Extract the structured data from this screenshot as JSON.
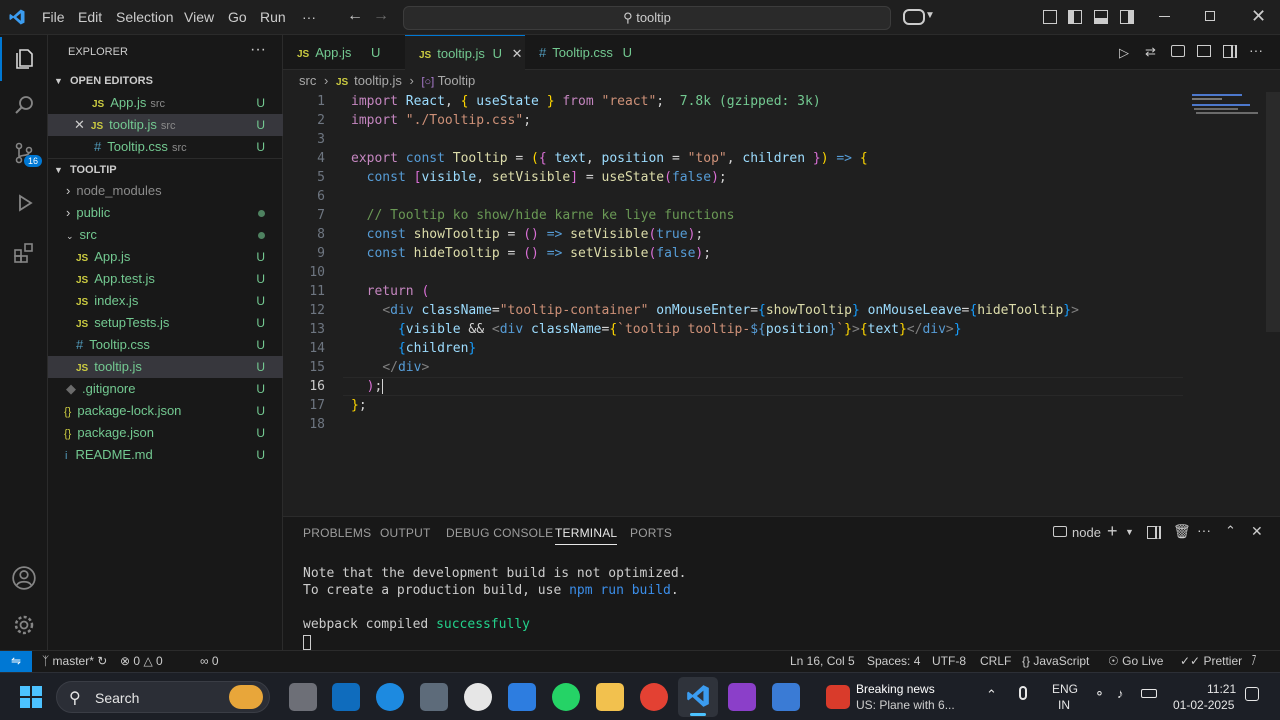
{
  "menu": [
    "File",
    "Edit",
    "Selection",
    "View",
    "Go",
    "Run",
    "···"
  ],
  "command_center": "tooltip",
  "explorer": {
    "title": "EXPLORER",
    "open_editors_label": "OPEN EDITORS",
    "open_editors": [
      {
        "icon": "JS",
        "name": "App.js",
        "dir": "src",
        "status": "U"
      },
      {
        "icon": "JS",
        "name": "tooltip.js",
        "dir": "src",
        "status": "U"
      },
      {
        "icon": "#",
        "name": "Tooltip.css",
        "dir": "src",
        "status": "U"
      }
    ],
    "project_label": "TOOLTIP",
    "tree": [
      {
        "name": "node_modules",
        "status": ""
      },
      {
        "name": "public",
        "status": "dot"
      },
      {
        "name": "src",
        "status": "dot"
      },
      {
        "name": "App.js",
        "icon": "JS",
        "status": "U"
      },
      {
        "name": "App.test.js",
        "icon": "JS",
        "status": "U"
      },
      {
        "name": "index.js",
        "icon": "JS",
        "status": "U"
      },
      {
        "name": "setupTests.js",
        "icon": "JS",
        "status": "U"
      },
      {
        "name": "Tooltip.css",
        "icon": "#",
        "status": "U"
      },
      {
        "name": "tooltip.js",
        "icon": "JS",
        "status": "U"
      },
      {
        "name": ".gitignore",
        "status": "U"
      },
      {
        "name": "package-lock.json",
        "icon": "{}",
        "status": "U"
      },
      {
        "name": "package.json",
        "icon": "{}",
        "status": "U"
      },
      {
        "name": "README.md",
        "icon": "i",
        "status": "U"
      }
    ],
    "source_control_badge": "16"
  },
  "tabs": [
    {
      "icon": "JS",
      "label": "App.js",
      "status": "U"
    },
    {
      "icon": "JS",
      "label": "tooltip.js",
      "status": "U"
    },
    {
      "icon": "#",
      "label": "Tooltip.css",
      "status": "U"
    }
  ],
  "breadcrumb": {
    "a": "src",
    "b": "tooltip.js",
    "c": "Tooltip"
  },
  "line_numbers": [
    "1",
    "2",
    "3",
    "4",
    "5",
    "6",
    "7",
    "8",
    "9",
    "10",
    "11",
    "12",
    "13",
    "14",
    "15",
    "16",
    "17",
    "18"
  ],
  "code_hint": "7.8k (gzipped: 3k)",
  "panel": {
    "tabs": [
      "PROBLEMS",
      "OUTPUT",
      "DEBUG CONSOLE",
      "TERMINAL",
      "PORTS"
    ],
    "shell": "node",
    "lines": [
      "Note that the development build is not optimized.",
      "To create a production build, use ",
      "npm run build",
      "webpack compiled ",
      "successfully"
    ]
  },
  "status": {
    "branch": "master*",
    "errors": "0",
    "warnings": "0",
    "ports": "0",
    "position": "Ln 16, Col 5",
    "spaces": "Spaces: 4",
    "encoding": "UTF-8",
    "eol": "CRLF",
    "language": "JavaScript",
    "go_live": "Go Live",
    "prettier": "Prettier"
  },
  "taskbar": {
    "search": "Search",
    "news_title": "Breaking news",
    "news_sub": "US: Plane with 6...",
    "lang": "ENG",
    "region": "IN",
    "time": "11:21",
    "date": "01-02-2025"
  },
  "colors": {
    "accent": "#0078d4",
    "git_untracked": "#73c991",
    "editor_bg": "#1f1f1f",
    "sidebar_bg": "#181818"
  }
}
